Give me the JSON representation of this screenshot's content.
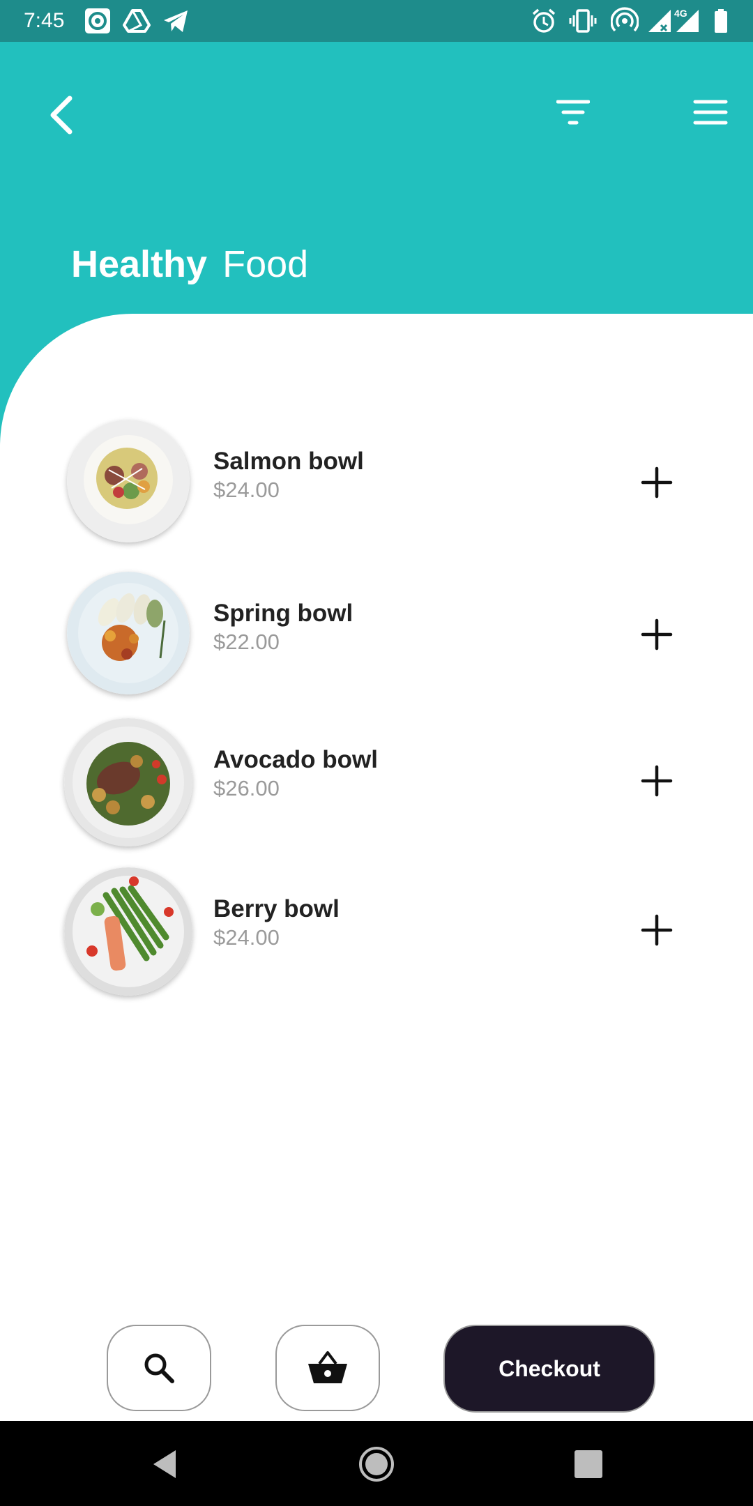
{
  "status_bar": {
    "time": "7:45",
    "left_icons": [
      "radio-app-icon",
      "drive-icon",
      "telegram-icon"
    ],
    "right_icons": [
      "alarm-icon",
      "vibrate-icon",
      "hotspot-icon",
      "signal-icon",
      "signal-4g-icon",
      "battery-icon"
    ],
    "network_label": "4G"
  },
  "header": {
    "back_icon": "chevron-left-icon",
    "filter_icon": "filter-icon",
    "menu_icon": "hamburger-menu-icon",
    "title_bold": "Healthy",
    "title_light": "Food"
  },
  "items": [
    {
      "name": "Salmon bowl",
      "price": "$24.00",
      "add_icon": "plus-icon"
    },
    {
      "name": "Spring bowl",
      "price": "$22.00",
      "add_icon": "plus-icon"
    },
    {
      "name": "Avocado bowl",
      "price": "$26.00",
      "add_icon": "plus-icon"
    },
    {
      "name": "Berry bowl",
      "price": "$24.00",
      "add_icon": "plus-icon"
    }
  ],
  "bottom_bar": {
    "search_icon": "search-icon",
    "basket_icon": "basket-icon",
    "checkout_label": "Checkout"
  },
  "colors": {
    "accent": "#22c0be",
    "status_bar": "#1e8c8b",
    "checkout_bg": "#1d1728",
    "price_text": "#9a9a9a"
  }
}
